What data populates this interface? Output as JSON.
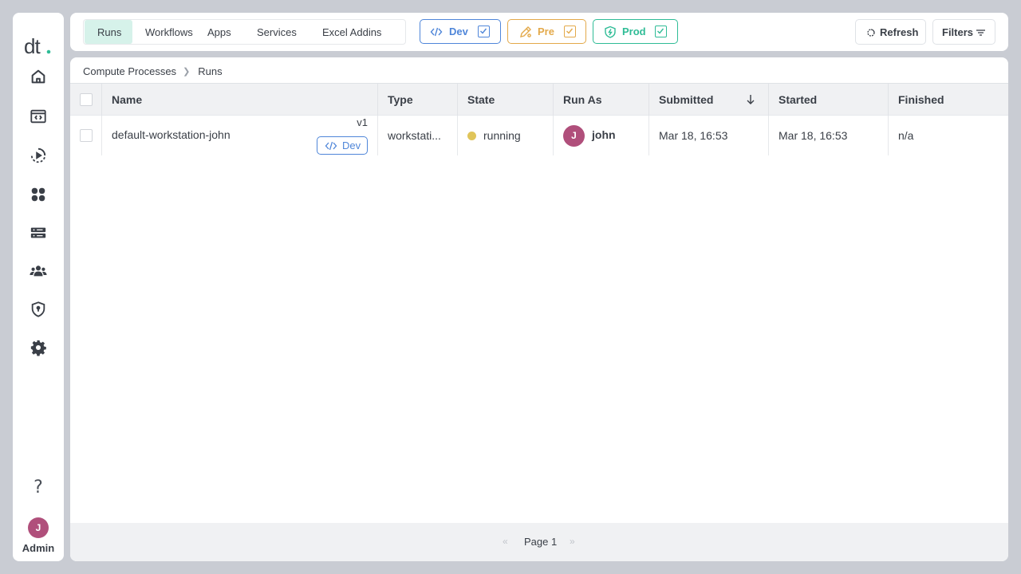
{
  "sidebar": {
    "logo_text": "dt.",
    "items": [
      {
        "icon": "home-icon"
      },
      {
        "icon": "code-window-icon"
      },
      {
        "icon": "runs-play-icon"
      },
      {
        "icon": "apps-grid-icon"
      },
      {
        "icon": "server-icon"
      },
      {
        "icon": "users-icon"
      },
      {
        "icon": "shield-lock-icon"
      },
      {
        "icon": "gear-icon"
      }
    ],
    "help_label": "?",
    "user_initial": "J",
    "user_role": "Admin"
  },
  "topbar": {
    "tabs": [
      {
        "label": "Runs",
        "active": true
      },
      {
        "label": "Workflows"
      },
      {
        "label": "Apps"
      },
      {
        "label": "Services"
      },
      {
        "label": "Excel Addins"
      }
    ],
    "envs": [
      {
        "label": "Dev",
        "color": "#4f86d9",
        "checked": true
      },
      {
        "label": "Pre",
        "color": "#e3a94a",
        "checked": true
      },
      {
        "label": "Prod",
        "color": "#2fbc96",
        "checked": true
      }
    ],
    "refresh_label": "Refresh",
    "filters_label": "Filters"
  },
  "breadcrumb": [
    "Compute Processes",
    "Runs"
  ],
  "table": {
    "columns": [
      "Name",
      "Type",
      "State",
      "Run As",
      "Submitted",
      "Started",
      "Finished"
    ],
    "rows": [
      {
        "name": "default-workstation-john",
        "version": "v1",
        "env_tag": "Dev",
        "type": "workstati...",
        "state": "running",
        "state_color": "#e0c55a",
        "run_as_initial": "J",
        "run_as": "john",
        "submitted": "Mar 18, 16:53",
        "started": "Mar 18, 16:53",
        "finished": "n/a"
      }
    ]
  },
  "pagination": {
    "prev": "«",
    "label": "Page 1",
    "next": "»"
  },
  "colors": {
    "accent": "#2fbc96",
    "avatar": "#b04f7b",
    "page_bg": "#c9ccd3"
  }
}
